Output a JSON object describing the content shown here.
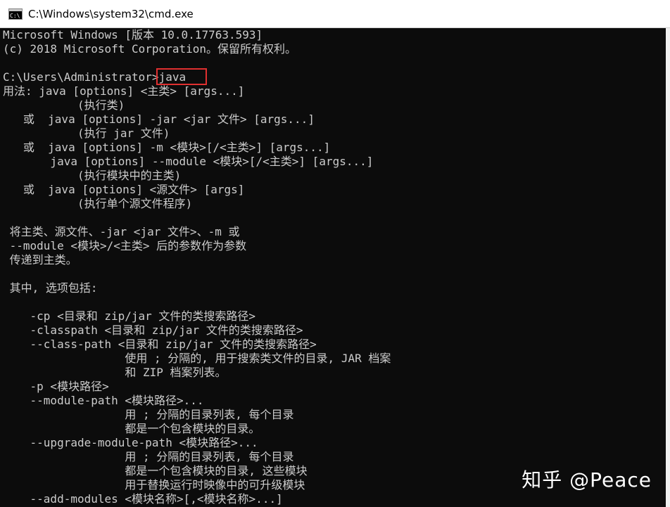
{
  "window": {
    "title": "C:\\Windows\\system32\\cmd.exe",
    "icon": "cmd-icon"
  },
  "console": {
    "lines": [
      "Microsoft Windows [版本 10.0.17763.593]",
      "(c) 2018 Microsoft Corporation。保留所有权利。",
      "",
      "C:\\Users\\Administrator>java",
      "用法: java [options] <主类> [args...]",
      "           (执行类)",
      "   或  java [options] -jar <jar 文件> [args...]",
      "           (执行 jar 文件)",
      "   或  java [options] -m <模块>[/<主类>] [args...]",
      "       java [options] --module <模块>[/<主类>] [args...]",
      "           (执行模块中的主类)",
      "   或  java [options] <源文件> [args]",
      "           (执行单个源文件程序)",
      "",
      " 将主类、源文件、-jar <jar 文件>、-m 或",
      " --module <模块>/<主类> 后的参数作为参数",
      " 传递到主类。",
      "",
      " 其中, 选项包括:",
      "",
      "    -cp <目录和 zip/jar 文件的类搜索路径>",
      "    -classpath <目录和 zip/jar 文件的类搜索路径>",
      "    --class-path <目录和 zip/jar 文件的类搜索路径>",
      "                  使用 ; 分隔的, 用于搜索类文件的目录, JAR 档案",
      "                  和 ZIP 档案列表。",
      "    -p <模块路径>",
      "    --module-path <模块路径>...",
      "                  用 ; 分隔的目录列表, 每个目录",
      "                  都是一个包含模块的目录。",
      "    --upgrade-module-path <模块路径>...",
      "                  用 ; 分隔的目录列表, 每个目录",
      "                  都是一个包含模块的目录, 这些模块",
      "                  用于替换运行时映像中的可升级模块",
      "    --add-modules <模块名称>[,<模块名称>...]"
    ]
  },
  "watermark": "知乎 @Peace",
  "colors": {
    "console_bg": "#0c0c0c",
    "console_text": "#cccccc",
    "highlight": "#e03030"
  }
}
